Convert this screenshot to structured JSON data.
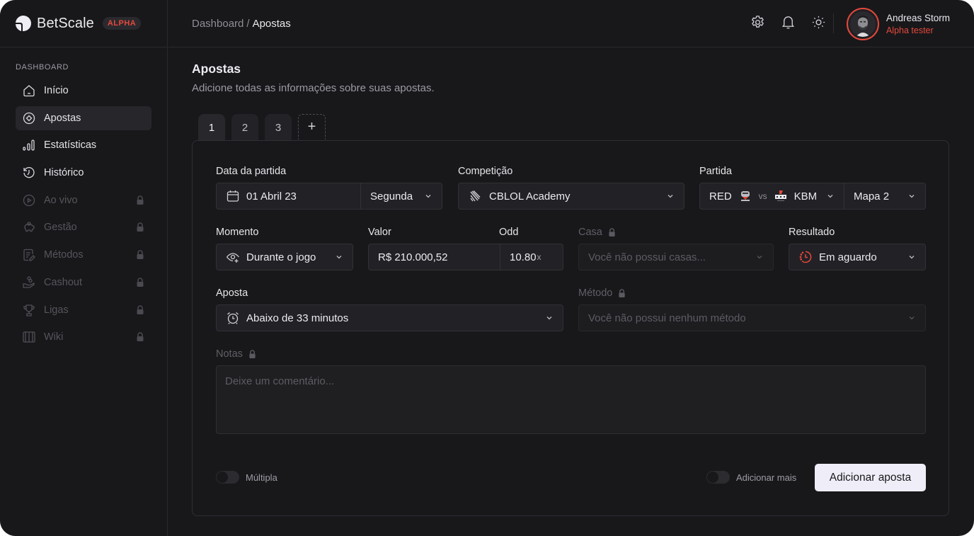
{
  "brand": {
    "name": "BetScale",
    "badge": "ALPHA",
    "accent": "#e5483b"
  },
  "sidebar": {
    "section_label": "DASHBOARD",
    "items": [
      {
        "label": "Início",
        "icon": "home-icon",
        "active": false,
        "locked": false
      },
      {
        "label": "Apostas",
        "icon": "target-icon",
        "active": true,
        "locked": false
      },
      {
        "label": "Estatísticas",
        "icon": "bar-chart-icon",
        "active": false,
        "locked": false
      },
      {
        "label": "Histórico",
        "icon": "history-icon",
        "active": false,
        "locked": false
      },
      {
        "label": "Ao vivo",
        "icon": "play-circle-icon",
        "active": false,
        "locked": true
      },
      {
        "label": "Gestão",
        "icon": "piggy-bank-icon",
        "active": false,
        "locked": true
      },
      {
        "label": "Métodos",
        "icon": "document-edit-icon",
        "active": false,
        "locked": true
      },
      {
        "label": "Cashout",
        "icon": "hand-coins-icon",
        "active": false,
        "locked": true
      },
      {
        "label": "Ligas",
        "icon": "trophy-icon",
        "active": false,
        "locked": true
      },
      {
        "label": "Wiki",
        "icon": "book-icon",
        "active": false,
        "locked": true
      }
    ]
  },
  "header": {
    "breadcrumb": {
      "parent": "Dashboard",
      "separator": "/",
      "current": "Apostas"
    },
    "icons": [
      "settings-icon",
      "bell-icon",
      "sun-icon"
    ],
    "user": {
      "name": "Andreas Storm",
      "role": "Alpha tester"
    }
  },
  "page": {
    "title": "Apostas",
    "subtitle": "Adicione todas as informações sobre suas apostas."
  },
  "tabs": [
    {
      "label": "1",
      "active": true
    },
    {
      "label": "2",
      "active": false
    },
    {
      "label": "3",
      "active": false
    }
  ],
  "add_tab_label": "+",
  "form": {
    "date": {
      "label": "Data da partida",
      "value": "01 Abril 23",
      "weekday": "Segunda"
    },
    "competition": {
      "label": "Competição",
      "value": "CBLOL Academy"
    },
    "match": {
      "label": "Partida",
      "team_a": "RED",
      "vs": "vs",
      "team_b": "KBM",
      "map": "Mapa 2"
    },
    "moment": {
      "label": "Momento",
      "value": "Durante o jogo"
    },
    "amount": {
      "label": "Valor",
      "value": "R$ 210.000,52"
    },
    "odd": {
      "label": "Odd",
      "value": "10.80",
      "suffix": "x"
    },
    "house": {
      "label": "Casa",
      "placeholder": "Você não possui casas...",
      "locked": true
    },
    "result": {
      "label": "Resultado",
      "value": "Em aguardo",
      "status_color": "#e5483b"
    },
    "bet": {
      "label": "Aposta",
      "value": "Abaixo de 33 minutos"
    },
    "method": {
      "label": "Método",
      "placeholder": "Você não possui nenhum método",
      "locked": true
    },
    "notes": {
      "label": "Notas",
      "placeholder": "Deixe um comentário...",
      "locked": true
    },
    "multiple_toggle": {
      "label": "Múltipla",
      "on": false
    },
    "add_more_toggle": {
      "label": "Adicionar mais",
      "on": false
    },
    "submit_label": "Adicionar aposta"
  }
}
